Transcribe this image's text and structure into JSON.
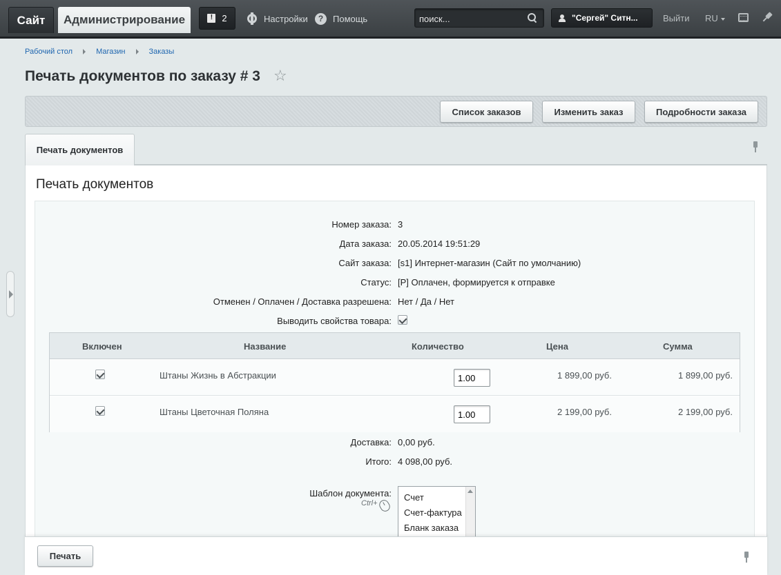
{
  "topbar": {
    "site_tab": "Сайт",
    "admin_tab": "Администрирование",
    "notifications_count": "2",
    "settings_label": "Настройки",
    "help_label": "Помощь",
    "search_placeholder": "поиск...",
    "user_name": "\"Сергей\" Ситн...",
    "logout_label": "Выйти",
    "lang_label": "RU"
  },
  "breadcrumb": {
    "items": [
      "Рабочий стол",
      "Магазин",
      "Заказы"
    ]
  },
  "page": {
    "title": "Печать документов по заказу # 3"
  },
  "toolbar": {
    "orders_list": "Список заказов",
    "edit_order": "Изменить заказ",
    "order_details": "Подробности заказа"
  },
  "tabs": {
    "active_label": "Печать документов"
  },
  "panel": {
    "heading": "Печать документов"
  },
  "order": {
    "number_label": "Номер заказа:",
    "number_value": "3",
    "date_label": "Дата заказа:",
    "date_value": "20.05.2014 19:51:29",
    "site_label": "Сайт заказа:",
    "site_value": "[s1] Интернет-магазин (Сайт по умолчанию)",
    "status_label": "Статус:",
    "status_value": "[P] Оплачен, формируется к отправке",
    "flags_label": "Отменен / Оплачен / Доставка разрешена",
    "flags_sep": ":",
    "flags_value": "Нет / Да / Нет",
    "props_label": "Выводить свойства товара:",
    "props_checked": true
  },
  "items_table": {
    "columns": [
      "Включен",
      "Название",
      "Количество",
      "Цена",
      "Сумма"
    ],
    "rows": [
      {
        "enabled": true,
        "name": "Штаны Жизнь в Абстракции",
        "quantity": "1.00",
        "price": "1 899,00 руб.",
        "sum": "1 899,00 руб."
      },
      {
        "enabled": true,
        "name": "Штаны Цветочная Поляна",
        "quantity": "1.00",
        "price": "2 199,00 руб.",
        "sum": "2 199,00 руб."
      }
    ]
  },
  "totals": {
    "delivery_label": "Доставка:",
    "delivery_value": "0,00 руб.",
    "total_label": "Итого:",
    "total_value": "4 098,00 руб."
  },
  "template": {
    "label": "Шаблон документа:",
    "hint": "Ctrl+",
    "options": [
      "Счет",
      "Счет-фактура",
      "Бланк заказа"
    ]
  },
  "footer": {
    "print_button": "Печать"
  }
}
